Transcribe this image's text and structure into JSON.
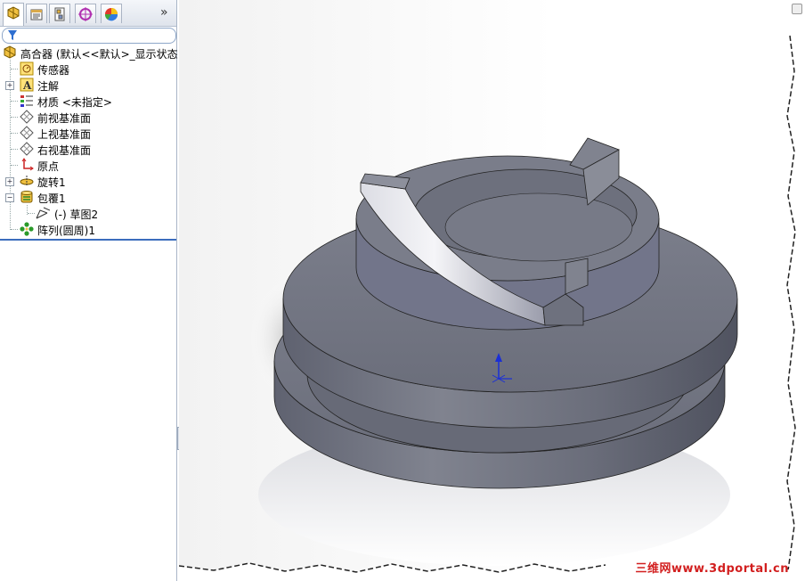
{
  "tabs": [
    {
      "name": "featuremanager-tab",
      "icon": "featuremanager-icon"
    },
    {
      "name": "propertymanager-tab",
      "icon": "propertymanager-icon"
    },
    {
      "name": "configurationmanager-tab",
      "icon": "configurationmanager-icon"
    },
    {
      "name": "dimxpert-tab",
      "icon": "dimxpert-icon"
    },
    {
      "name": "display-manager-tab",
      "icon": "display-manager-icon"
    }
  ],
  "expand_label": "»",
  "tree": {
    "root": "高合器  (默认<<默认>_显示状态",
    "items": [
      {
        "label": "传感器",
        "icon": "sensor-icon"
      },
      {
        "label": "注解",
        "icon": "annotation-icon"
      },
      {
        "label": "材质 <未指定>",
        "icon": "material-icon"
      },
      {
        "label": "前视基准面",
        "icon": "plane-icon"
      },
      {
        "label": "上视基准面",
        "icon": "plane-icon"
      },
      {
        "label": "右视基准面",
        "icon": "plane-icon"
      },
      {
        "label": "原点",
        "icon": "origin-icon"
      },
      {
        "label": "旋转1",
        "icon": "revolve-icon"
      },
      {
        "label": "包覆1",
        "icon": "wrap-icon"
      },
      {
        "label": "(-) 草图2",
        "icon": "sketch-icon"
      },
      {
        "label": "阵列(圆周)1",
        "icon": "circular-pattern-icon"
      }
    ]
  },
  "watermark": "三维网www.3dportal.cn",
  "colors": {
    "model": "#6e7180",
    "model_light": "#a9abb6",
    "selection_line": "#3b6dbd",
    "triad": "#1a2fd6"
  }
}
